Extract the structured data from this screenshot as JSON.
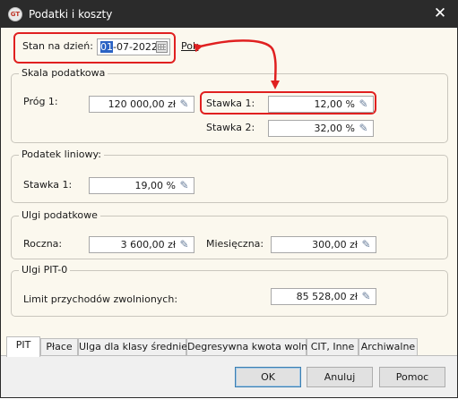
{
  "window": {
    "title": "Podatki i koszty",
    "app_icon_text": "GT",
    "close_symbol": "✕"
  },
  "date": {
    "label": "Stan na dzień:",
    "value_selected": "01",
    "value_rest": "-07-2022",
    "link_label": "Pok"
  },
  "skala": {
    "title": "Skala podatkowa",
    "prog1_label": "Próg 1:",
    "prog1_value": "120 000,00 zł",
    "stawka1_label": "Stawka 1:",
    "stawka1_value": "12,00 %",
    "stawka2_label": "Stawka 2:",
    "stawka2_value": "32,00 %"
  },
  "liniowy": {
    "title": "Podatek liniowy:",
    "stawka1_label": "Stawka 1:",
    "stawka1_value": "19,00 %"
  },
  "ulgi": {
    "title": "Ulgi podatkowe",
    "roczna_label": "Roczna:",
    "roczna_value": "3 600,00 zł",
    "miesieczna_label": "Miesięczna:",
    "miesieczna_value": "300,00 zł"
  },
  "pit0": {
    "title": "Ulgi PIT-0",
    "limit_label": "Limit przychodów zwolnionych:",
    "limit_value": "85 528,00 zł"
  },
  "tabs": [
    "PIT",
    "Płace",
    "Ulga dla klasy średniej",
    "Degresywna kwota wolna",
    "CIT, Inne",
    "Archiwalne"
  ],
  "buttons": {
    "ok": "OK",
    "cancel": "Anuluj",
    "help": "Pomoc"
  },
  "icons": {
    "edit": "pencil-icon",
    "calendar": "calendar-icon",
    "close": "close-icon"
  },
  "colors": {
    "highlight": "#e02020",
    "selection": "#2a62c4",
    "titlebar": "#2b2b2b",
    "panel": "#fbf8ee"
  }
}
